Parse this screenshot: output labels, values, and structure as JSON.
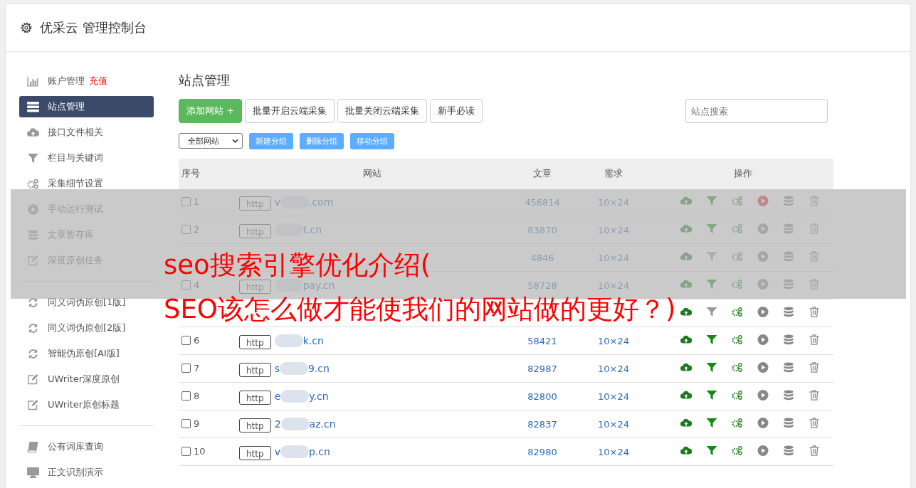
{
  "header": {
    "title": "优采云 管理控制台"
  },
  "sidebar": {
    "groups": [
      {
        "items": [
          {
            "kind": "chart",
            "label": "账户管理",
            "badge": "充值",
            "selected": false
          },
          {
            "kind": "server",
            "label": "站点管理",
            "selected": true
          },
          {
            "kind": "cloud",
            "label": "接口文件相关",
            "selected": false
          },
          {
            "kind": "filter",
            "label": "栏目与关键词",
            "selected": false
          },
          {
            "kind": "gears",
            "label": "采集细节设置",
            "selected": false
          },
          {
            "kind": "play",
            "label": "手动运行测试",
            "selected": false
          },
          {
            "kind": "db",
            "label": "文章暂存库",
            "selected": false
          },
          {
            "kind": "edit",
            "label": "深度原创任务",
            "selected": false
          }
        ]
      },
      {
        "items": [
          {
            "kind": "refresh",
            "label": "同义词伪原创[1版]",
            "selected": false
          },
          {
            "kind": "refresh",
            "label": "同义词伪原创[2版]",
            "selected": false
          },
          {
            "kind": "refresh",
            "label": "智能伪原创[AI版]",
            "selected": false
          },
          {
            "kind": "edit",
            "label": "UWriter深度原创",
            "selected": false
          },
          {
            "kind": "edit",
            "label": "UWriter原创标题",
            "selected": false
          }
        ]
      },
      {
        "items": [
          {
            "kind": "book",
            "label": "公有词库查询",
            "selected": false
          },
          {
            "kind": "monitor",
            "label": "正文识别演示",
            "selected": false
          }
        ]
      }
    ]
  },
  "main": {
    "title": "站点管理",
    "buttons": [
      {
        "kind": "primary",
        "label": "添加网站 +"
      },
      {
        "kind": "default",
        "label": "批量开启云端采集"
      },
      {
        "kind": "default",
        "label": "批量关闭云端采集"
      },
      {
        "kind": "default",
        "label": "新手必读"
      }
    ],
    "search": {
      "placeholder": "站点搜索"
    },
    "group_select": {
      "value": "全部网站"
    },
    "group_buttons": [
      "新建分组",
      "删除分组",
      "移动分组"
    ],
    "table": {
      "columns": [
        "序号",
        "网站",
        "文章",
        "需求",
        "操作"
      ],
      "rows": [
        {
          "checked": false,
          "index": "1",
          "protocol": "http",
          "site_prefix": "v",
          "site_suffix": ".com",
          "articles": "456814",
          "demand": "10×24",
          "filter_on": true,
          "running": true
        },
        {
          "checked": false,
          "index": "2",
          "protocol": "http",
          "site_suffix": "t.cn",
          "articles": "83870",
          "demand": "10×24",
          "filter_on": true,
          "running": false
        },
        {
          "articles": "4846",
          "demand": "10×24",
          "filter_on": false,
          "running": false
        },
        {
          "checked": false,
          "index": "4",
          "protocol": "http",
          "site_suffix": "pay.cn",
          "articles": "58728",
          "demand": "10×24",
          "filter_on": true,
          "running": false
        },
        {
          "filter_on": false,
          "running": false
        },
        {
          "checked": false,
          "index": "6",
          "protocol": "http",
          "site_suffix": "k.cn",
          "articles": "58421",
          "demand": "10×24",
          "filter_on": true,
          "running": false
        },
        {
          "checked": false,
          "index": "7",
          "protocol": "http",
          "site_prefix": "s",
          "site_suffix": "9.cn",
          "articles": "82987",
          "demand": "10×24",
          "filter_on": true,
          "running": false
        },
        {
          "checked": false,
          "index": "8",
          "protocol": "http",
          "site_prefix": "e",
          "site_suffix": "y.cn",
          "articles": "82800",
          "demand": "10×24",
          "filter_on": true,
          "running": false
        },
        {
          "checked": false,
          "index": "9",
          "protocol": "http",
          "site_prefix": "2",
          "site_suffix": "az.cn",
          "articles": "82837",
          "demand": "10×24",
          "filter_on": true,
          "running": false
        },
        {
          "checked": false,
          "index": "10",
          "protocol": "http",
          "site_prefix": "v",
          "site_suffix": "p.cn",
          "articles": "82980",
          "demand": "10×24",
          "filter_on": true,
          "running": false
        }
      ]
    }
  },
  "banner": {
    "lines": [
      "seo搜索引擎优化介绍(",
      "SEO该怎么做才能使我们的网站做的更好？)"
    ]
  }
}
